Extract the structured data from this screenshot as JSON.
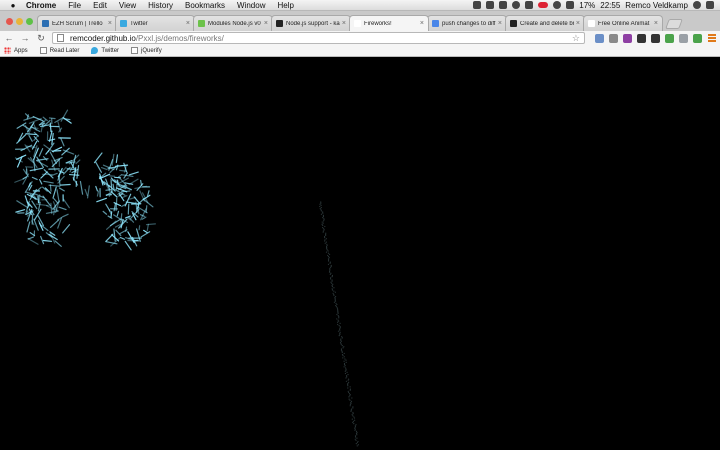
{
  "menubar": {
    "app_name": "Chrome",
    "items": [
      "File",
      "Edit",
      "View",
      "History",
      "Bookmarks",
      "Window",
      "Help"
    ],
    "battery": "17%",
    "time": "22:55",
    "user": "Remco Veldkamp"
  },
  "tabs": [
    {
      "title": "EZH Scrum | Trello",
      "favicon_color": "#2c6fb3",
      "active": false
    },
    {
      "title": "Twitter",
      "favicon_color": "#39a9e0",
      "active": false
    },
    {
      "title": "Modules Node.js v0",
      "favicon_color": "#6cc24a",
      "active": false
    },
    {
      "title": "Node.js support - ka",
      "favicon_color": "#222222",
      "active": false
    },
    {
      "title": "Fireworks!",
      "favicon_color": "#ffffff",
      "active": true
    },
    {
      "title": "push changes to diff",
      "favicon_color": "#4a86e8",
      "active": false
    },
    {
      "title": "Create and delete br",
      "favicon_color": "#222222",
      "active": false
    },
    {
      "title": "Free Online Animat",
      "favicon_color": "#ffffff",
      "active": false
    }
  ],
  "toolbar": {
    "url_host": "remcoder.github.io",
    "url_path": "/Pxxl.js/demos/fireworks/"
  },
  "extensions": [
    "#6b8fc7",
    "#8a8a8a",
    "#8e3fa3",
    "#333333",
    "#333333",
    "#4ba34b",
    "#9aa0a6",
    "#4ba34b"
  ],
  "bookmarks": [
    "Apps",
    "Read Later",
    "Twitter",
    "jQuerify"
  ],
  "page": {
    "particle_color": "#8fe8ff"
  }
}
